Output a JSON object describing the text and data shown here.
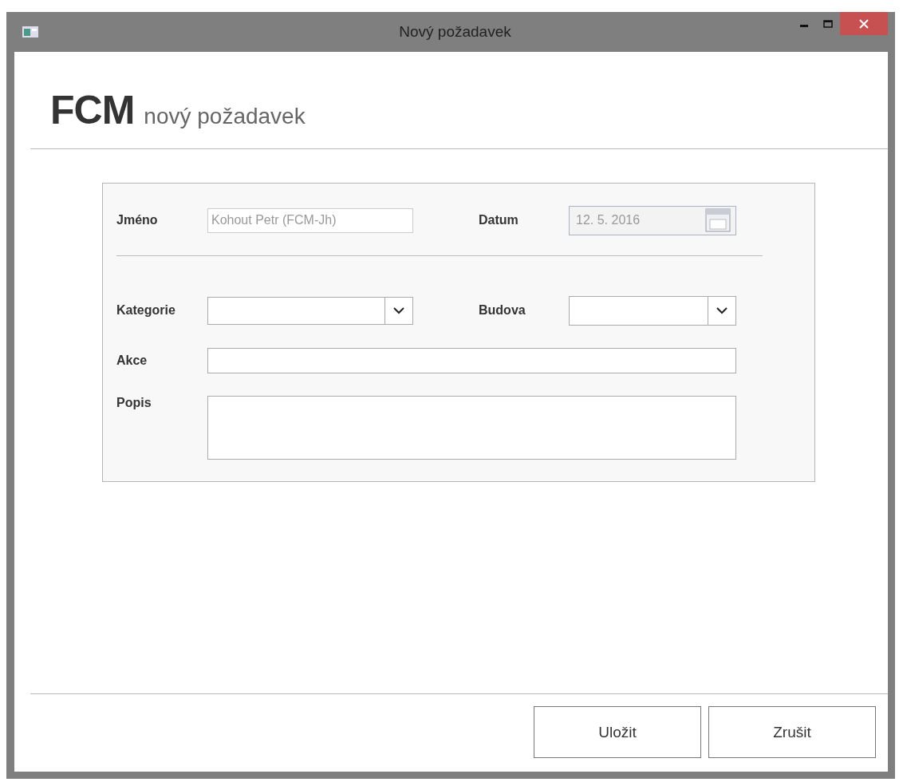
{
  "window": {
    "title": "Nový požadavek"
  },
  "heading": {
    "brand": "FCM",
    "subtitle": "nový požadavek"
  },
  "form": {
    "top_row": [
      {
        "label": "Jméno",
        "kind": "text",
        "value": "Kohout Petr (FCM-Jh)",
        "disabled": true
      },
      {
        "label": "Datum",
        "kind": "date",
        "value": "12. 5. 2016",
        "disabled": true
      }
    ],
    "select_row": [
      {
        "label": "Kategorie",
        "kind": "select"
      },
      {
        "label": "Budova",
        "kind": "select"
      }
    ],
    "wide_rows": [
      {
        "label": "Akce",
        "kind": "text"
      },
      {
        "label": "Popis",
        "kind": "textarea"
      }
    ]
  },
  "buttons": [
    "Uložit",
    "Zrušit"
  ]
}
